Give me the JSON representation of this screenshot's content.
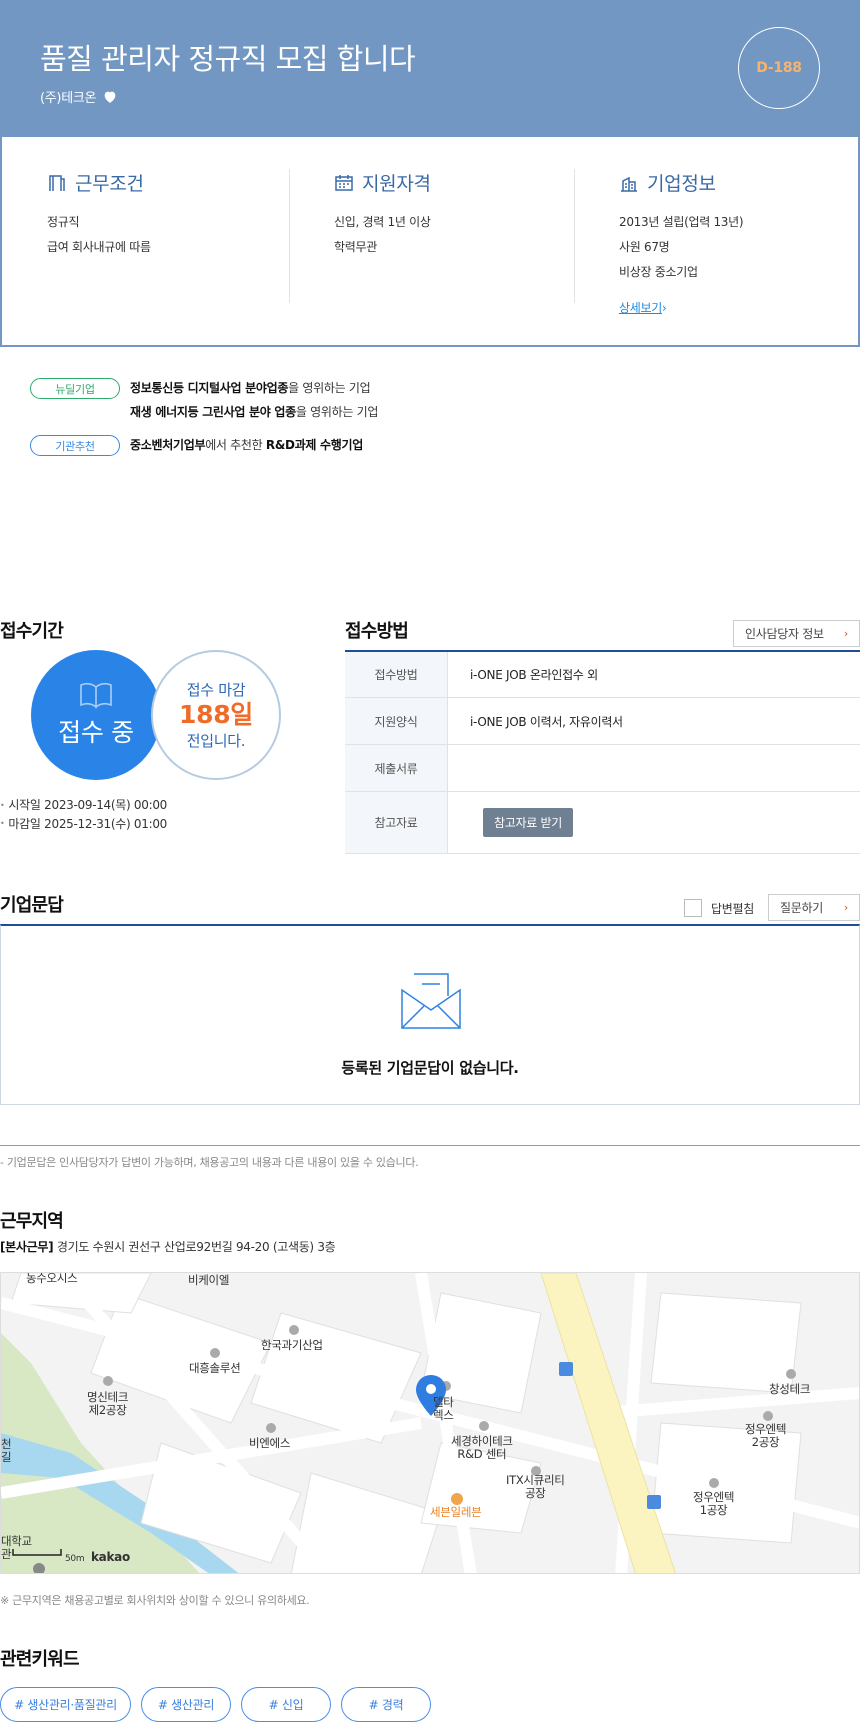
{
  "header": {
    "title": "품질 관리자 정규직 모집 합니다",
    "company": "(주)테크온",
    "dday": "D-188"
  },
  "conditions": {
    "work": {
      "title": "근무조건",
      "lines": [
        "정규직",
        "급여 회사내규에 따름"
      ]
    },
    "qualification": {
      "title": "지원자격",
      "lines": [
        "신입, 경력 1년 이상",
        "학력무관"
      ]
    },
    "company": {
      "title": "기업정보",
      "lines": [
        "2013년 설립(업력 13년)",
        "사원 67명",
        "비상장 중소기업"
      ],
      "detail_link": "상세보기"
    }
  },
  "badges": {
    "newdeal": {
      "label": "뉴딜기업",
      "line1": {
        "b1": "정보통신등 디지털사업 분야업종",
        "t1": "을 영위하는 기업"
      },
      "line2": {
        "b1": "재생 에너지등 그린사업 분야 업종",
        "t1": "을 영위하는 기업"
      }
    },
    "agency": {
      "label": "기관추천",
      "line1": {
        "b1": "중소벤처기업부",
        "t1": "에서 추천한 ",
        "b2": "R&D과제 수행기업"
      }
    }
  },
  "period": {
    "title": "접수기간",
    "status": "접수 중",
    "deadline_l1": "접수 마감",
    "deadline_days": "188일",
    "deadline_l3": "전입니다.",
    "start": "시작일 2023-09-14(목) 00:00",
    "end": "마감일 2025-12-31(수) 01:00"
  },
  "method": {
    "title": "접수방법",
    "hr_button": "인사담당자 정보",
    "rows": [
      {
        "key": "접수방법",
        "value": "i-ONE JOB 온라인접수 외"
      },
      {
        "key": "지원양식",
        "value": "i-ONE JOB 이력서, 자유이력서"
      },
      {
        "key": "제출서류",
        "value": ""
      },
      {
        "key": "참고자료",
        "value": ""
      }
    ],
    "ref_button": "참고자료 받기"
  },
  "qna": {
    "title": "기업문답",
    "checkbox_label": "답변펼침",
    "ask_button": "질문하기",
    "empty": "등록된 기업문답이 없습니다.",
    "note": "- 기업문답은 인사담당자가 답변이 가능하며, 채용공고의 내용과 다른 내용이 있을 수 있습니다."
  },
  "location": {
    "title": "근무지역",
    "addr_tag": "[본사근무]",
    "addr": " 경기도 수원시 권선구 산업로92번길 94-20 (고색동) 3층",
    "map_labels": {
      "l1": "농수오시스",
      "l2": "비케이엘",
      "l3": "한국과기산업",
      "l4": "대흥솔루션",
      "l5a": "명신테크",
      "l5b": "제2공장",
      "l6": "비엔에스",
      "l7a": "델타",
      "l7b": "렉스",
      "l8a": "세경하이테크",
      "l8b": "R&D 센터",
      "l9a": "ITX시큐리티",
      "l9b": "공장",
      "l10": "세븐일레븐",
      "l11": "창성테크",
      "l12a": "정우엔텍",
      "l12b": "2공장",
      "l13a": "정우엔텍",
      "l13b": "1공장",
      "l14a": "천",
      "l14b": "길",
      "l15a": "대학교",
      "l15b": "관"
    },
    "scale": "50m",
    "brand": "kakao",
    "note": "※ 근무지역은 채용공고별로 회사위치와 상이할 수 있으니 유의하세요."
  },
  "keywords": {
    "title": "관련키워드",
    "items": [
      "# 생산관리·품질관리",
      "# 생산관리",
      "# 신입",
      "# 경력"
    ]
  }
}
